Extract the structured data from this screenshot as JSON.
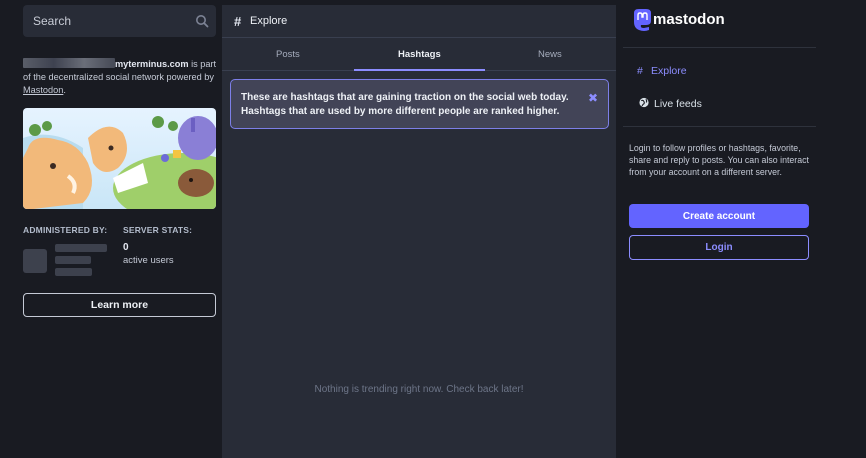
{
  "search": {
    "placeholder": "Search",
    "icon": "search-icon"
  },
  "about": {
    "domain": "myterminus.com",
    "text_after_domain": " is part of the decentralized social network powered by ",
    "link": "Mastodon",
    "trail": "."
  },
  "admin": {
    "label": "ADMINISTERED BY:"
  },
  "stats": {
    "label": "SERVER STATS:",
    "active_users": "0",
    "active_users_label": "active users"
  },
  "learn_more": "Learn more",
  "column": {
    "title": "Explore",
    "icon": "hashtag-icon"
  },
  "tabs": [
    {
      "label": "Posts",
      "active": false
    },
    {
      "label": "Hashtags",
      "active": true
    },
    {
      "label": "News",
      "active": false
    }
  ],
  "notice": {
    "text": "These are hashtags that are gaining traction on the social web today. Hashtags that are used by more different people are ranked higher.",
    "close": "✖"
  },
  "empty_message": "Nothing is trending right now. Check back later!",
  "brand": "mastodon",
  "nav": {
    "explore": {
      "label": "Explore",
      "icon": "hashtag-icon"
    },
    "live": {
      "label": "Live feeds",
      "icon": "globe-icon"
    }
  },
  "signup": {
    "text": "Login to follow profiles or hashtags, favorite, share and reply to posts. You can also interact from your account on a different server.",
    "create": "Create account",
    "login": "Login"
  },
  "colors": {
    "accent": "#6364ff",
    "accent_light": "#8c8dff",
    "bg": "#191b22",
    "panel": "#282c37"
  }
}
